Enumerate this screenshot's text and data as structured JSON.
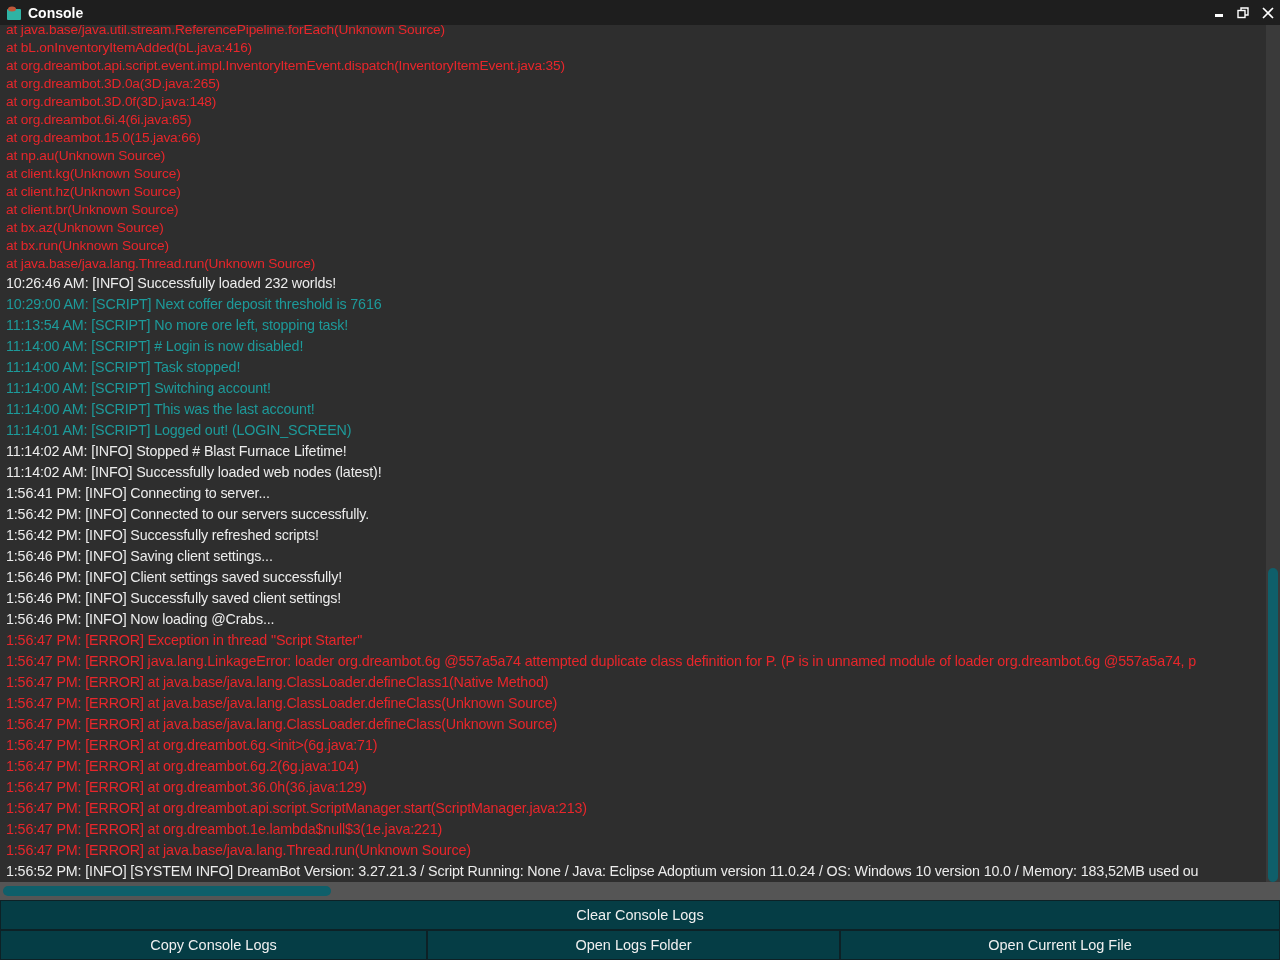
{
  "window": {
    "title": "Console"
  },
  "log_lines": [
    {
      "kind": "trace",
      "text": "at java.base/java.util.stream.ReferencePipeline.forEach(Unknown Source)"
    },
    {
      "kind": "trace",
      "text": "at bL.onInventoryItemAdded(bL.java:416)"
    },
    {
      "kind": "trace",
      "text": "at org.dreambot.api.script.event.impl.InventoryItemEvent.dispatch(InventoryItemEvent.java:35)"
    },
    {
      "kind": "trace",
      "text": "at org.dreambot.3D.0a(3D.java:265)"
    },
    {
      "kind": "trace",
      "text": "at org.dreambot.3D.0f(3D.java:148)"
    },
    {
      "kind": "trace",
      "text": "at org.dreambot.6i.4(6i.java:65)"
    },
    {
      "kind": "trace",
      "text": "at org.dreambot.15.0(15.java:66)"
    },
    {
      "kind": "trace",
      "text": "at np.au(Unknown Source)"
    },
    {
      "kind": "trace",
      "text": "at client.kg(Unknown Source)"
    },
    {
      "kind": "trace",
      "text": "at client.hz(Unknown Source)"
    },
    {
      "kind": "trace",
      "text": "at client.br(Unknown Source)"
    },
    {
      "kind": "trace",
      "text": "at bx.az(Unknown Source)"
    },
    {
      "kind": "trace",
      "text": "at bx.run(Unknown Source)"
    },
    {
      "kind": "trace",
      "text": "at java.base/java.lang.Thread.run(Unknown Source)"
    },
    {
      "kind": "info",
      "text": "10:26:46 AM: [INFO] Successfully loaded 232 worlds!"
    },
    {
      "kind": "script",
      "text": "10:29:00 AM: [SCRIPT] Next coffer deposit threshold is 7616"
    },
    {
      "kind": "script",
      "text": "11:13:54 AM: [SCRIPT] No more ore left, stopping task!"
    },
    {
      "kind": "script",
      "text": "11:14:00 AM: [SCRIPT] # Login is now disabled!"
    },
    {
      "kind": "script",
      "text": "11:14:00 AM: [SCRIPT] Task stopped!"
    },
    {
      "kind": "script",
      "text": "11:14:00 AM: [SCRIPT] Switching account!"
    },
    {
      "kind": "script",
      "text": "11:14:00 AM: [SCRIPT] This was the last account!"
    },
    {
      "kind": "script",
      "text": "11:14:01 AM: [SCRIPT] Logged out! (LOGIN_SCREEN)"
    },
    {
      "kind": "info",
      "text": "11:14:02 AM: [INFO] Stopped # Blast Furnace Lifetime!"
    },
    {
      "kind": "info",
      "text": "11:14:02 AM: [INFO] Successfully loaded web nodes (latest)!"
    },
    {
      "kind": "info",
      "text": "1:56:41 PM: [INFO] Connecting to server..."
    },
    {
      "kind": "info",
      "text": "1:56:42 PM: [INFO] Connected to our servers successfully."
    },
    {
      "kind": "info",
      "text": "1:56:42 PM: [INFO] Successfully refreshed scripts!"
    },
    {
      "kind": "info",
      "text": "1:56:46 PM: [INFO] Saving client settings..."
    },
    {
      "kind": "info",
      "text": "1:56:46 PM: [INFO] Client settings saved successfully!"
    },
    {
      "kind": "info",
      "text": "1:56:46 PM: [INFO] Successfully saved client settings!"
    },
    {
      "kind": "info",
      "text": "1:56:46 PM: [INFO] Now loading @Crabs..."
    },
    {
      "kind": "error",
      "text": "1:56:47 PM: [ERROR] Exception in thread \"Script Starter\""
    },
    {
      "kind": "error",
      "text": "1:56:47 PM: [ERROR] java.lang.LinkageError: loader org.dreambot.6g @557a5a74 attempted duplicate class definition for P. (P is in unnamed module of loader org.dreambot.6g @557a5a74, p"
    },
    {
      "kind": "error",
      "text": "1:56:47 PM: [ERROR] at java.base/java.lang.ClassLoader.defineClass1(Native Method)"
    },
    {
      "kind": "error",
      "text": "1:56:47 PM: [ERROR] at java.base/java.lang.ClassLoader.defineClass(Unknown Source)"
    },
    {
      "kind": "error",
      "text": "1:56:47 PM: [ERROR] at java.base/java.lang.ClassLoader.defineClass(Unknown Source)"
    },
    {
      "kind": "error",
      "text": "1:56:47 PM: [ERROR] at org.dreambot.6g.<init>(6g.java:71)"
    },
    {
      "kind": "error",
      "text": "1:56:47 PM: [ERROR] at org.dreambot.6g.2(6g.java:104)"
    },
    {
      "kind": "error",
      "text": "1:56:47 PM: [ERROR] at org.dreambot.36.0h(36.java:129)"
    },
    {
      "kind": "error",
      "text": "1:56:47 PM: [ERROR] at org.dreambot.api.script.ScriptManager.start(ScriptManager.java:213)"
    },
    {
      "kind": "error",
      "text": "1:56:47 PM: [ERROR] at org.dreambot.1e.lambda$null$3(1e.java:221)"
    },
    {
      "kind": "error",
      "text": "1:56:47 PM: [ERROR] at java.base/java.lang.Thread.run(Unknown Source)"
    },
    {
      "kind": "info",
      "text": "1:56:52 PM: [INFO] [SYSTEM INFO] DreamBot Version: 3.27.21.3 / Script Running: None / Java: Eclipse Adoptium version 11.0.24 / OS: Windows 10 version 10.0 / Memory: 183,52MB used ou"
    }
  ],
  "buttons": {
    "clear": "Clear Console Logs",
    "row": [
      "Copy Console Logs",
      "Open Logs Folder",
      "Open Current Log File"
    ]
  }
}
